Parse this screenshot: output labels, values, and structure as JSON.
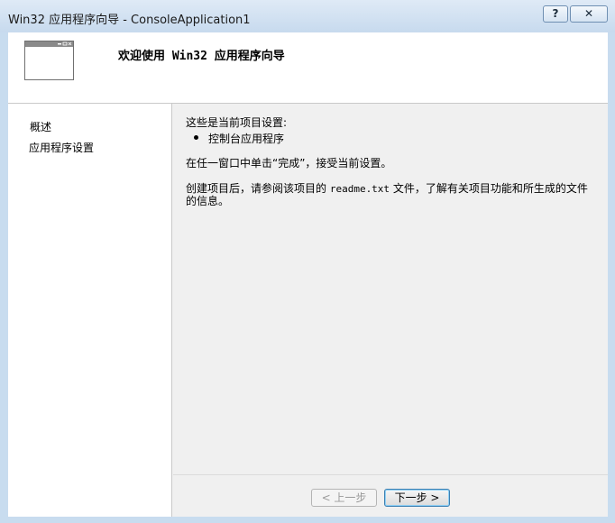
{
  "window": {
    "title": "Win32 应用程序向导 - ConsoleApplication1",
    "help_label": "?",
    "close_label": "✕"
  },
  "banner": {
    "title": "欢迎使用 Win32 应用程序向导",
    "icon": "window-icon"
  },
  "sidebar": {
    "items": [
      {
        "label": "概述"
      },
      {
        "label": "应用程序设置"
      }
    ]
  },
  "content": {
    "heading": "这些是当前项目设置:",
    "bullets": [
      "控制台应用程序"
    ],
    "instruction": "在任一窗口中单击“完成”，接受当前设置。",
    "info_prefix": "创建项目后，请参阅该项目的 ",
    "info_file": "readme.txt",
    "info_suffix": " 文件，了解有关项目功能和所生成的文件",
    "info_line2": "的信息。"
  },
  "buttons": {
    "prev_label": "< 上一步",
    "next_label": "下一步 >"
  }
}
